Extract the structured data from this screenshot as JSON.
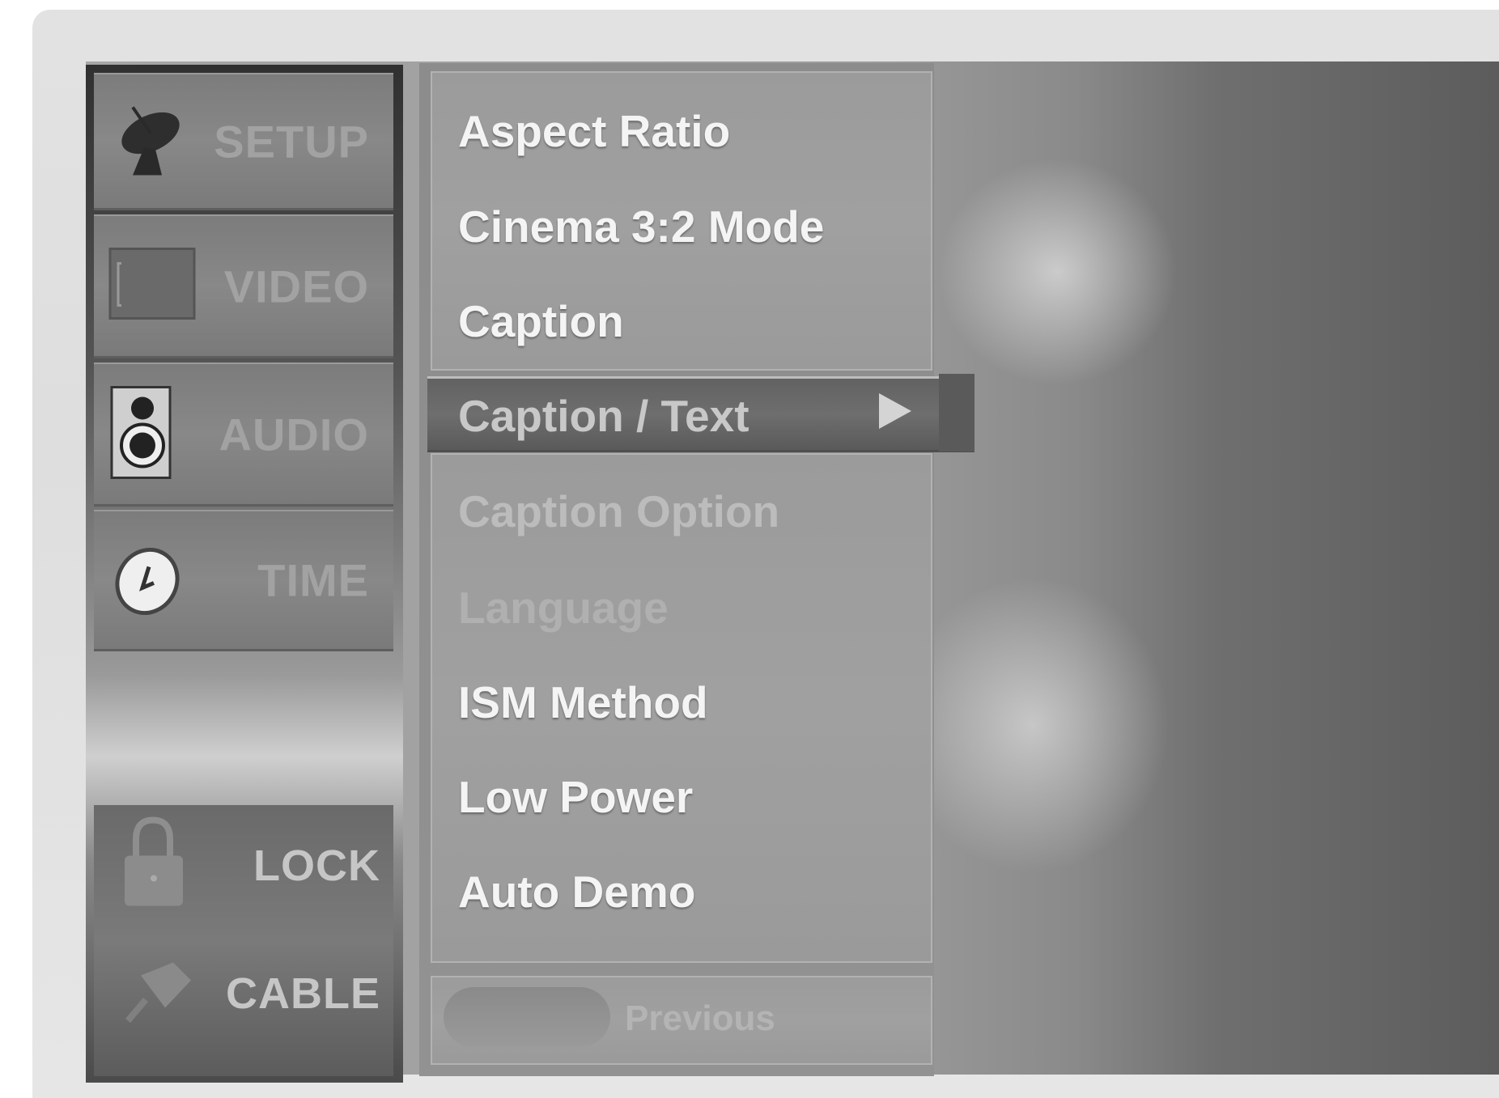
{
  "categories": [
    {
      "id": "setup",
      "label": "SETUP",
      "icon": "satellite-dish-icon"
    },
    {
      "id": "video",
      "label": "VIDEO",
      "icon": "screen-icon"
    },
    {
      "id": "audio",
      "label": "AUDIO",
      "icon": "speaker-icon"
    },
    {
      "id": "time",
      "label": "TIME",
      "icon": "clock-icon"
    },
    {
      "id": "lock",
      "label": "LOCK",
      "icon": "padlock-icon"
    },
    {
      "id": "cable",
      "label": "CABLE",
      "icon": "cable-plug-icon"
    }
  ],
  "menu": {
    "items": [
      {
        "label": "Aspect Ratio",
        "state": "normal"
      },
      {
        "label": "Cinema 3:2 Mode",
        "state": "normal"
      },
      {
        "label": "Caption",
        "state": "normal"
      },
      {
        "label": "Caption / Text",
        "state": "selected",
        "has_submenu": true
      },
      {
        "label": "Caption Option",
        "state": "disabled"
      },
      {
        "label": "Language",
        "state": "faded"
      },
      {
        "label": "ISM Method",
        "state": "normal"
      },
      {
        "label": "Low Power",
        "state": "normal"
      },
      {
        "label": "Auto Demo",
        "state": "normal"
      }
    ],
    "submenu_arrow": "▶"
  },
  "footer": {
    "previous_label": "Previous"
  }
}
